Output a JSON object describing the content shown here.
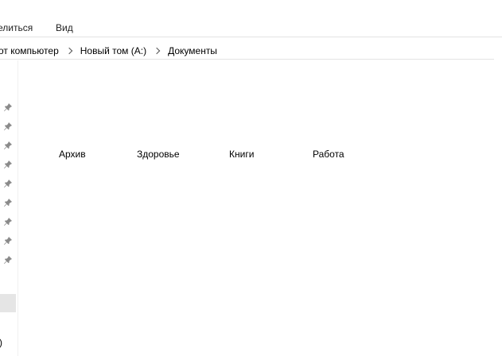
{
  "window": {
    "title_fragment": ""
  },
  "ribbon": {
    "tabs": [
      {
        "label": "елиться"
      },
      {
        "label": "Вид"
      }
    ]
  },
  "address_bar": {
    "crumbs": [
      "от компьютер",
      "Новый том (A:)",
      "Документы"
    ]
  },
  "nav_pane": {
    "pinned_icon": "pin-icon",
    "item_fragment": ")"
  },
  "content": {
    "folders": [
      {
        "label": "Архив"
      },
      {
        "label": "Здоровье"
      },
      {
        "label": "Книги"
      },
      {
        "label": "Работа"
      }
    ]
  }
}
